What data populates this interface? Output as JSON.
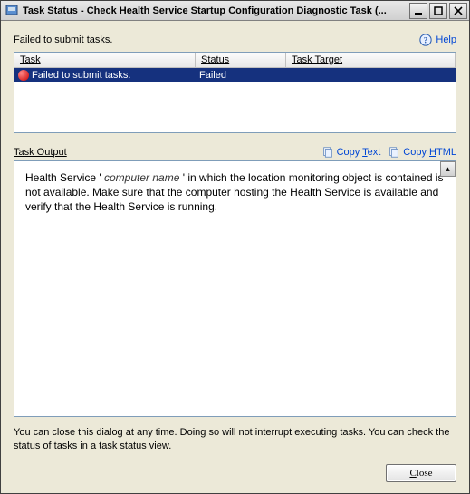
{
  "window": {
    "title": "Task Status - Check Health Service Startup Configuration Diagnostic Task (..."
  },
  "header": {
    "status_message": "Failed to submit tasks.",
    "help_label": "Help"
  },
  "task_table": {
    "columns": {
      "task": "Task",
      "status": "Status",
      "target": "Task Target"
    },
    "rows": [
      {
        "task": "Failed to submit tasks.",
        "status": "Failed",
        "target": ""
      }
    ]
  },
  "output": {
    "label": "Task Output",
    "copy_text_prefix": "Copy ",
    "copy_text_ul": "T",
    "copy_text_suffix": "ext",
    "copy_html_prefix": "Copy ",
    "copy_html_ul": "H",
    "copy_html_suffix": "TML",
    "body_prefix": "Health Service ' ",
    "body_var": "computer name",
    "body_suffix": " ' in which the location monitoring object is contained is not available. Make sure that the computer hosting the Health Service is available and verify that the Health Service is running."
  },
  "footer": {
    "note": "You can close this dialog at any time.  Doing so will not interrupt executing tasks.  You can check the status of tasks in a task status view.",
    "close_ul": "C",
    "close_suffix": "lose"
  }
}
